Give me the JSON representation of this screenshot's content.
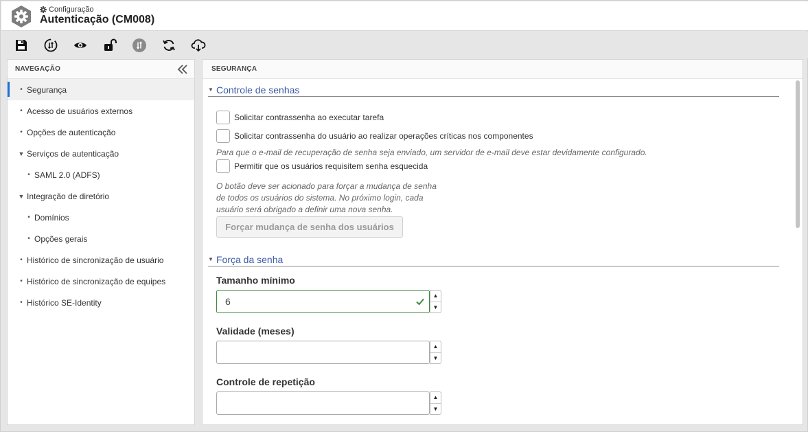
{
  "header": {
    "breadcrumb": "Configuração",
    "title": "Autenticação (CM008)"
  },
  "toolbar": {
    "buttons": [
      {
        "icon": "save-icon"
      },
      {
        "icon": "sync-info-icon"
      },
      {
        "icon": "eye-icon"
      },
      {
        "icon": "unlock-icon"
      },
      {
        "icon": "sync-disabled-icon"
      },
      {
        "icon": "refresh-icon"
      },
      {
        "icon": "cloud-download-icon"
      }
    ]
  },
  "navigation": {
    "header": "NAVEGAÇÃO",
    "items": [
      {
        "label": "Segurança",
        "active": true
      },
      {
        "label": "Acesso de usuários externos"
      },
      {
        "label": "Opções de autenticação"
      },
      {
        "label": "Serviços de autenticação",
        "expanded": true
      },
      {
        "label": "SAML 2.0 (ADFS)"
      },
      {
        "label": "Integração de diretório",
        "expanded": true
      },
      {
        "label": "Domínios"
      },
      {
        "label": "Opções gerais"
      },
      {
        "label": "Histórico de sincronização de usuário"
      },
      {
        "label": "Histórico de sincronização de equipes"
      },
      {
        "label": "Histórico SE-Identity"
      }
    ]
  },
  "content": {
    "header": "SEGURANÇA",
    "password_control": {
      "title": "Controle de senhas",
      "checkbox_task": "Solicitar contrassenha ao executar tarefa",
      "checkbox_critical": "Solicitar contrassenha do usuário ao realizar operações críticas nos componentes",
      "email_hint": "Para que o e-mail de recuperação de senha seja enviado, um servidor de e-mail deve estar devidamente configurado.",
      "checkbox_forgot": "Permitir que os usuários requisitem senha esquecida",
      "force_hint_1": "O botão deve ser acionado para forçar a mudança de senha",
      "force_hint_2": "de todos os usuários do sistema. No próximo login, cada",
      "force_hint_3": "usuário será obrigado a definir uma nova senha.",
      "force_button": "Forçar mudança de senha dos usuários"
    },
    "password_strength": {
      "title": "Força da senha",
      "min_length_label": "Tamanho mínimo",
      "min_length_value": "6",
      "validity_label": "Validade (meses)",
      "validity_value": "",
      "repetition_label": "Controle de repetição",
      "repetition_value": ""
    }
  },
  "colors": {
    "accent": "#1e6fd6",
    "section_title": "#3a5aa8",
    "valid": "#3c8a3c"
  }
}
